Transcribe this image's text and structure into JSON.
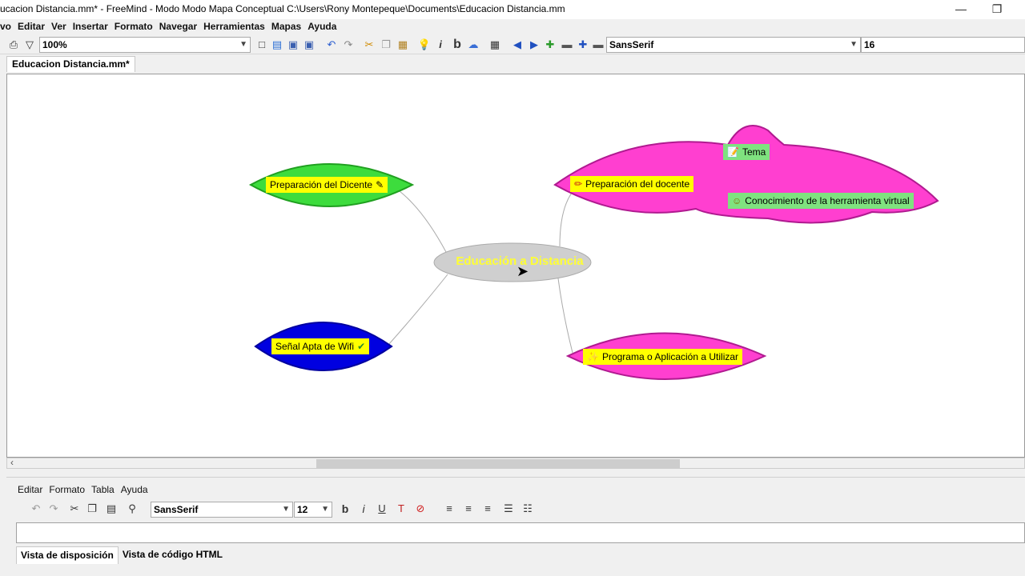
{
  "window": {
    "title": "ucacion  Distancia.mm* - FreeMind - Modo Modo Mapa Conceptual C:\\Users\\Rony Montepeque\\Documents\\Educacion  Distancia.mm",
    "minimize": "—",
    "restore": "❐"
  },
  "menubar": [
    "vo",
    "Editar",
    "Ver",
    "Insertar",
    "Formato",
    "Navegar",
    "Herramientas",
    "Mapas",
    "Ayuda"
  ],
  "toolbar": {
    "zoom": "100%",
    "font_family": "SansSerif",
    "font_size": "16",
    "icons": [
      "print-icon",
      "filter-icon",
      "new-icon",
      "open-icon",
      "save-icon",
      "save-as-icon",
      "undo-icon",
      "redo-icon",
      "cut-icon",
      "copy-icon",
      "paste-icon",
      "idea-icon",
      "italic-icon",
      "bold-icon",
      "cloud-icon",
      "grid-icon",
      "back-icon",
      "forward-icon",
      "add-icon",
      "remove-icon",
      "zoom-in-icon",
      "zoom-out-icon"
    ]
  },
  "document_tab": "Educacion  Distancia.mm*",
  "mindmap": {
    "root": "Educación a Distancia",
    "nodes": [
      {
        "id": "prep-dicente",
        "label": "Preparación del Dicente",
        "icon": "✎",
        "shape_color": "#3ddc3d"
      },
      {
        "id": "senal-wifi",
        "label": "Señal Apta de Wifi",
        "icon": "✔",
        "shape_color": "#0000e0"
      },
      {
        "id": "prep-docente",
        "label": "Preparación del docente",
        "icon": "✏",
        "shape_color": "#ff3fd0"
      },
      {
        "id": "tema",
        "label": "Tema",
        "icon": "📝"
      },
      {
        "id": "conocimiento",
        "label": "Conocimiento de la herramienta virtual",
        "icon": "☺"
      },
      {
        "id": "programa",
        "label": "Programa o Aplicación  a Utilizar",
        "icon": "✨",
        "shape_color": "#ff3fd0"
      }
    ]
  },
  "editor": {
    "menu": [
      "Editar",
      "Formato",
      "Tabla",
      "Ayuda"
    ],
    "font_family": "SansSerif",
    "font_size": "12",
    "tabs": [
      "Vista de disposición",
      "Vista de código HTML"
    ],
    "buttons": {
      "bold": "b",
      "italic": "i",
      "underline": "U"
    }
  }
}
